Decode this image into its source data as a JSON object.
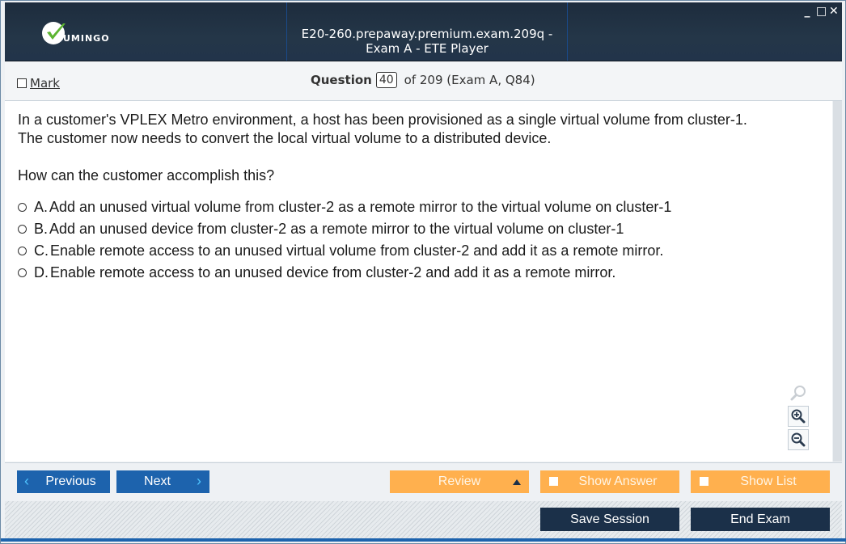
{
  "window": {
    "title": "E20-260.prepaway.premium.exam.209q - Exam A - ETE Player",
    "logo_text": "UMINGO",
    "controls": {
      "minimize": "_",
      "maximize": "□",
      "close": "✕"
    }
  },
  "header": {
    "mark_label": "Mark",
    "question_label": "Question",
    "question_number": "40",
    "question_of": "of 209 (Exam A, Q84)"
  },
  "question": {
    "text_line1": "In a customer's VPLEX Metro environment, a host has been provisioned as a single virtual volume from cluster-1.",
    "text_line2": "The customer now needs to convert the local virtual volume to a distributed device.",
    "prompt": "How can the customer accomplish this?",
    "answers": [
      {
        "letter": "A.",
        "text": "Add an unused virtual volume from cluster-2 as a remote mirror to the virtual volume on cluster-1"
      },
      {
        "letter": "B.",
        "text": "Add an unused device from cluster-2 as a remote mirror to the virtual volume on cluster-1"
      },
      {
        "letter": "C.",
        "text": "Enable remote access to an unused virtual volume from cluster-2 and add it as a remote mirror."
      },
      {
        "letter": "D.",
        "text": "Enable remote access to an unused device from cluster-2 and add it as a remote mirror."
      }
    ]
  },
  "nav": {
    "previous": "Previous",
    "next": "Next",
    "review": "Review",
    "show_answer": "Show Answer",
    "show_list": "Show List",
    "save_session": "Save Session",
    "end_exam": "End Exam"
  },
  "colors": {
    "titlebar": "#243648",
    "nav_blue": "#1d63ad",
    "nav_orange": "#ffb04e",
    "nav_dark": "#1b3049",
    "logo_green": "#5cb531"
  },
  "icons": {
    "zoom_reset": "search-icon",
    "zoom_in": "zoom-in-icon",
    "zoom_out": "zoom-out-icon"
  }
}
